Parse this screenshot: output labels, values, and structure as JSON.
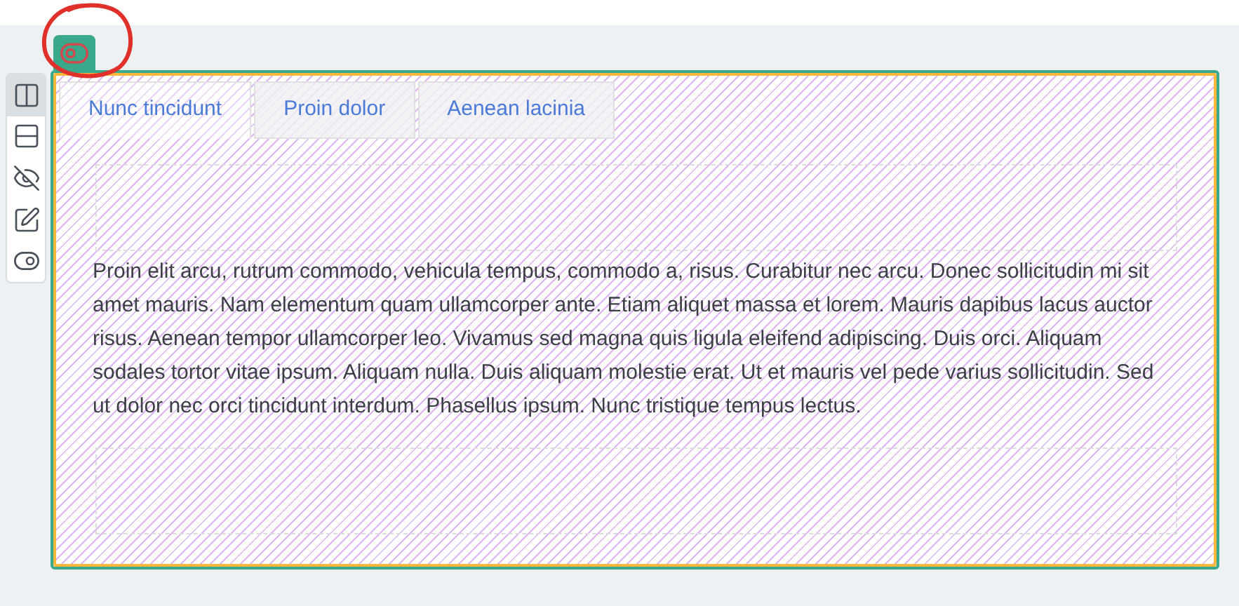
{
  "toolbar": [
    {
      "kind": "columns",
      "selected": true
    },
    {
      "kind": "rows",
      "selected": false
    },
    {
      "kind": "hide",
      "selected": false
    },
    {
      "kind": "edit",
      "selected": false
    },
    {
      "kind": "toggle",
      "selected": false
    }
  ],
  "tabs": [
    {
      "label": "Nunc tincidunt",
      "selected": true
    },
    {
      "label": "Proin dolor",
      "selected": false
    },
    {
      "label": "Aenean lacinia",
      "selected": false
    }
  ],
  "paragraph": "Proin elit arcu, rutrum commodo, vehicula tempus, commodo a, risus. Curabitur nec arcu. Donec sollicitudin mi sit amet mauris. Nam elementum quam ullamcorper ante. Etiam aliquet massa et lorem. Mauris dapibus lacus auctor risus. Aenean tempor ullamcorper leo. Vivamus sed magna quis ligula eleifend adipiscing. Duis orci. Aliquam sodales tortor vitae ipsum. Aliquam nulla. Duis aliquam molestie erat. Ut et mauris vel pede varius sollicitudin. Sed ut dolor nec orci tincidunt interdum. Phasellus ipsum. Nunc tristique tempus lectus."
}
